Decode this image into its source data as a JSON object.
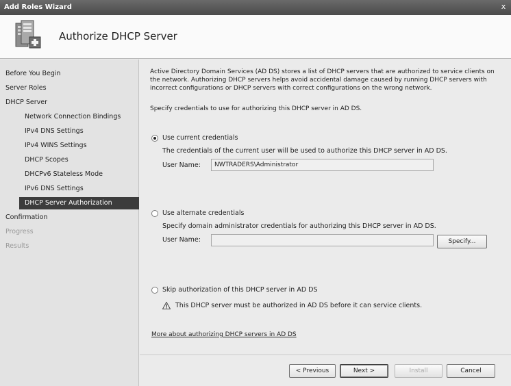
{
  "window": {
    "title": "Add Roles Wizard",
    "close_glyph": "x"
  },
  "header": {
    "title": "Authorize DHCP Server",
    "icon": "server-role-icon"
  },
  "sidebar": {
    "items": [
      {
        "label": "Before You Begin"
      },
      {
        "label": "Server Roles"
      },
      {
        "label": "DHCP Server"
      },
      {
        "label": "Network Connection Bindings"
      },
      {
        "label": "IPv4 DNS Settings"
      },
      {
        "label": "IPv4 WINS Settings"
      },
      {
        "label": "DHCP Scopes"
      },
      {
        "label": "DHCPv6 Stateless Mode"
      },
      {
        "label": "IPv6 DNS Settings"
      },
      {
        "label": "DHCP Server Authorization"
      },
      {
        "label": "Confirmation"
      },
      {
        "label": "Progress"
      },
      {
        "label": "Results"
      }
    ]
  },
  "main": {
    "intro": "Active Directory Domain Services (AD DS) stores a list of DHCP servers that are authorized to service clients on the network. Authorizing DHCP servers helps avoid accidental damage caused by running DHCP servers with incorrect configurations or DHCP servers with correct configurations on the wrong network.",
    "specify": "Specify credentials to use for authorizing this DHCP server in AD DS.",
    "option_current": {
      "label": "Use current credentials",
      "description": "The credentials of the current user will be used to authorize this DHCP server in AD DS.",
      "user_label": "User Name:",
      "user_value": "NWTRADERS\\Administrator",
      "selected": true
    },
    "option_alternate": {
      "label": "Use alternate credentials",
      "description": "Specify domain administrator credentials for authorizing this DHCP server in AD DS.",
      "user_label": "User Name:",
      "user_value": "",
      "specify_button": "Specify..."
    },
    "option_skip": {
      "label": "Skip authorization of this DHCP server in AD DS",
      "warning": "This DHCP server must be authorized in AD DS before it can service clients."
    },
    "more_link": "More about authorizing DHCP servers in AD DS"
  },
  "footer": {
    "previous": "< Previous",
    "next": "Next >",
    "install": "Install",
    "cancel": "Cancel"
  }
}
